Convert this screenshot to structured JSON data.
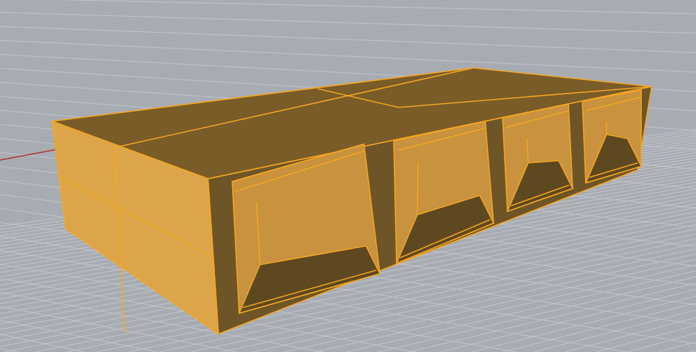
{
  "viewport": {
    "grid": true,
    "model": {
      "selected": true
    }
  }
}
